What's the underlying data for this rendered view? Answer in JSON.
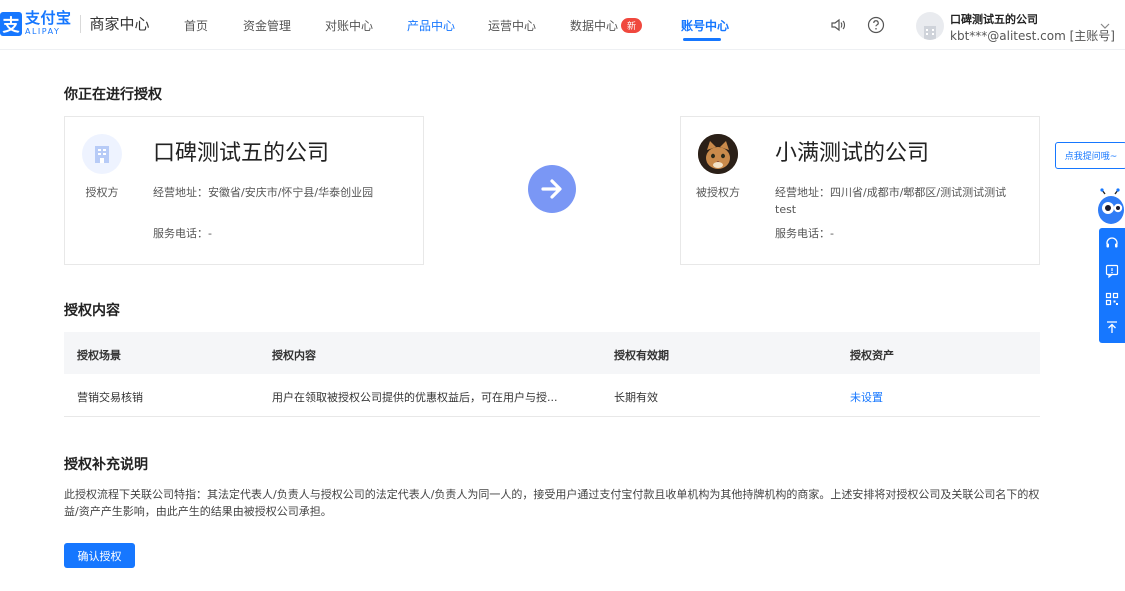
{
  "header": {
    "logo_cn": "支付宝",
    "logo_en": "ALIPAY",
    "logo_mark": "支",
    "subtitle": "商家中心",
    "nav": [
      {
        "label": "首页",
        "active": false
      },
      {
        "label": "资金管理",
        "active": false
      },
      {
        "label": "对账中心",
        "active": false
      },
      {
        "label": "产品中心",
        "active": false
      },
      {
        "label": "运营中心",
        "active": false
      },
      {
        "label": "数据中心",
        "active": false,
        "badge": "新"
      },
      {
        "label": "账号中心",
        "active": true
      }
    ],
    "icons": [
      "speaker-icon",
      "help-icon"
    ],
    "account_name": "口碑测试五的公司",
    "account_id": "kbt***@alitest.com [主账号]"
  },
  "main": {
    "title": "你正在进行授权",
    "grantor": {
      "name": "口碑测试五的公司",
      "role": "授权方",
      "address": "经营地址：安徽省/安庆市/怀宁县/华泰创业园",
      "phone": "服务电话：-"
    },
    "grantee": {
      "name": "小满测试的公司",
      "role": "被授权方",
      "address": "经营地址：四川省/成都市/郫都区/测试测试测试test",
      "phone": "服务电话：-"
    },
    "content_title": "授权内容",
    "table": {
      "headers": [
        "授权场景",
        "授权内容",
        "授权有效期",
        "授权资产"
      ],
      "rows": [
        [
          "营销交易核销",
          "用户在领取被授权公司提供的优惠权益后，可在用户与授...",
          "长期有效",
          "未设置"
        ]
      ]
    },
    "note_title": "授权补充说明",
    "note_text": "此授权流程下关联公司特指：其法定代表人/负责人与授权公司的法定代表人/负责人为同一人的，接受用户通过支付宝付款且收单机构为其他持牌机构的商家。上述安排将对授权公司及关联公司名下的权益/资产产生影响，由此产生的结果由被授权公司承担。",
    "confirm_label": "确认授权"
  },
  "float": {
    "bubble": "点我提问哦~",
    "side_icons": [
      "headset-icon",
      "feedback-icon",
      "qrcode-icon",
      "back-to-top-icon"
    ]
  },
  "colors": {
    "primary": "#1677ff",
    "arrow": "#7a97f5",
    "badge": "#f0483e",
    "table_head": "#f5f6f8"
  }
}
